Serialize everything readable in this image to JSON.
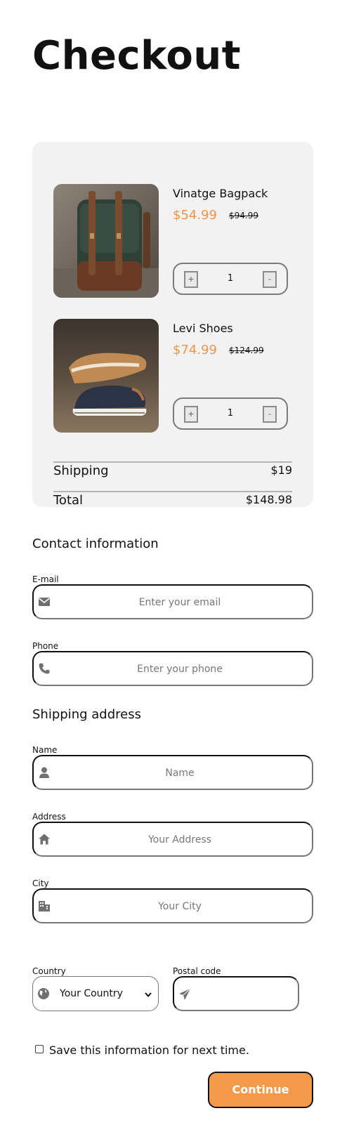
{
  "header": {
    "title": "Checkout"
  },
  "cart": {
    "items": [
      {
        "name": "Vinatge Bagpack",
        "price": "$54.99",
        "old_price": "$94.99",
        "quantity": "1",
        "plus": "+",
        "minus": "-"
      },
      {
        "name": "Levi Shoes",
        "price": "$74.99",
        "old_price": "$124.99",
        "quantity": "1",
        "plus": "+",
        "minus": "-"
      }
    ],
    "shipping_label": "Shipping",
    "shipping_value": "$19",
    "total_label": "Total",
    "total_value": "$148.98"
  },
  "contact": {
    "title": "Contact information",
    "email": {
      "label": "E-mail",
      "placeholder": "Enter your email",
      "icon": "envelope-icon"
    },
    "phone": {
      "label": "Phone",
      "placeholder": "Enter your phone",
      "icon": "phone-icon"
    }
  },
  "shipping": {
    "title": "Shipping address",
    "name": {
      "label": "Name",
      "placeholder": "Name",
      "icon": "user-icon"
    },
    "address": {
      "label": "Address",
      "placeholder": "Your Address",
      "icon": "home-icon"
    },
    "city": {
      "label": "City",
      "placeholder": "Your City",
      "icon": "building-icon"
    },
    "country": {
      "label": "Country",
      "value": "Your Country",
      "icon": "globe-icon"
    },
    "postal": {
      "label": "Postal code",
      "placeholder": "",
      "icon": "paper-plane-icon"
    }
  },
  "footer": {
    "save_label": "Save this information for next time.",
    "continue_label": "Continue"
  },
  "colors": {
    "accent": "#f5994a",
    "price": "#f0964a",
    "panel": "#f2f2f2"
  }
}
